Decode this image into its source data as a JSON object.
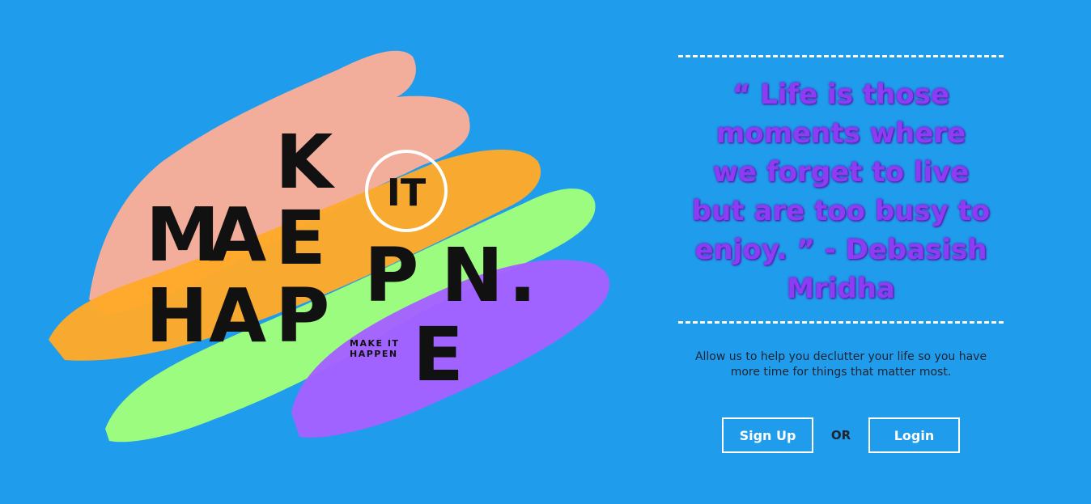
{
  "hero": {
    "logo_words": {
      "line1": [
        "M",
        "A",
        "K"
      ],
      "line1_e": "E",
      "line2": [
        "H",
        "A",
        "P",
        "P",
        "E",
        "N",
        "."
      ],
      "circle_text": "IT",
      "small_line1": "MAKE IT",
      "small_line2": "HAPPEN"
    },
    "stroke_colors": [
      "#f9ad98",
      "#ffa929",
      "#9fff7b",
      "#a561ff"
    ]
  },
  "quote": {
    "text": "“ Life is those moments where we forget to live but are too busy to enjoy. ” - Debasish Mridha"
  },
  "blurb": {
    "text": "Allow us to help you declutter your life so you have more time for things that matter most."
  },
  "actions": {
    "signup_label": "Sign Up",
    "or_label": "OR",
    "login_label": "Login"
  },
  "colors": {
    "background": "#209cec",
    "quote": "#8e3bf5",
    "button_border": "#ffffff"
  }
}
